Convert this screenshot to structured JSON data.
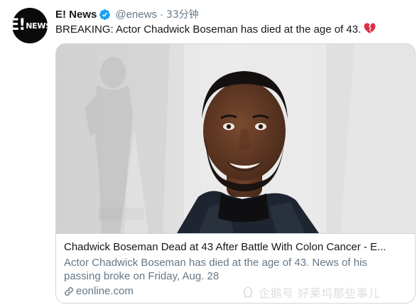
{
  "tweet": {
    "display_name": "E! News",
    "handle": "@enews",
    "separator": "·",
    "time": "33分钟",
    "verified": true,
    "verified_icon": "verified-badge-icon",
    "text": "BREAKING: Actor Chadwick Boseman has died at the age of 43.",
    "emoji": "broken-heart",
    "avatar": {
      "logo_top": "E!",
      "logo_bottom": "NEWS"
    }
  },
  "card": {
    "title": "Chadwick Boseman Dead at 43 After Battle With Colon Cancer - E...",
    "description": "Actor Chadwick Boseman has died at the age of 43. News of his passing broke on Friday, Aug. 28",
    "domain": "eonline.com",
    "link_icon": "link-icon"
  },
  "watermark": {
    "text": "企鹅号 好莱坞那些事儿"
  },
  "colors": {
    "accent": "#1da1f2",
    "text": "#14171a",
    "secondary": "#657786",
    "border": "#ccd6dd",
    "heart": "#e0245e"
  }
}
